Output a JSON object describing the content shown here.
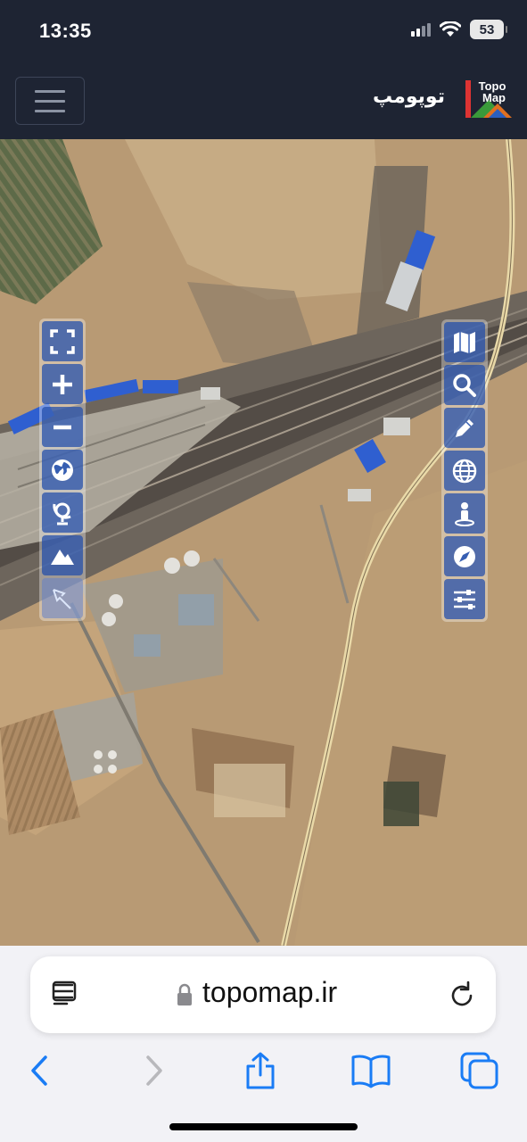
{
  "status_bar": {
    "time": "13:35",
    "battery": "53"
  },
  "header": {
    "site_title": "توپومپ",
    "logo_line1": "Topo",
    "logo_line2": "Map"
  },
  "map_controls": {
    "left": [
      "fullscreen-icon",
      "zoom-in-icon",
      "zoom-out-icon",
      "globe-icon",
      "3d-globe-icon",
      "terrain-icon",
      "pointer-icon"
    ],
    "right": [
      "map-layers-icon",
      "search-icon",
      "pencil-icon",
      "web-globe-icon",
      "street-view-icon",
      "compass-icon",
      "settings-sliders-icon"
    ]
  },
  "browser": {
    "url": "topomap.ir"
  },
  "colors": {
    "header_bg": "#1e2433",
    "control_blue": "#204caa",
    "safari_blue": "#1a7cf5"
  }
}
